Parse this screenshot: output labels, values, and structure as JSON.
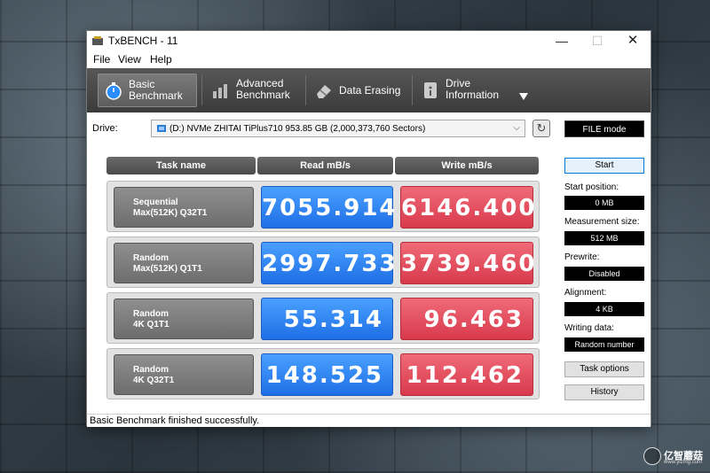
{
  "window": {
    "title": "TxBENCH - 11"
  },
  "menu": {
    "file": "File",
    "view": "View",
    "help": "Help"
  },
  "tabs": [
    {
      "label": "Basic\nBenchmark",
      "icon": "stopwatch-icon",
      "active": true
    },
    {
      "label": "Advanced\nBenchmark",
      "icon": "bar-chart-icon",
      "active": false
    },
    {
      "label": "Data Erasing",
      "icon": "eraser-icon",
      "active": false
    },
    {
      "label": "Drive\nInformation",
      "icon": "drive-info-icon",
      "active": false
    }
  ],
  "drive": {
    "label": "Drive:",
    "selected": "(D:) NVMe ZHITAI TiPlus710  953.85 GB (2,000,373,760 Sectors)",
    "mode_button": "FILE mode"
  },
  "table": {
    "headers": {
      "task": "Task name",
      "read": "Read mB/s",
      "write": "Write mB/s"
    },
    "rows": [
      {
        "line1": "Sequential",
        "line2": "Max(512K) Q32T1",
        "read": "7055.914",
        "write": "6146.400"
      },
      {
        "line1": "Random",
        "line2": "Max(512K) Q1T1",
        "read": "2997.733",
        "write": "3739.460"
      },
      {
        "line1": "Random",
        "line2": "4K Q1T1",
        "read": "55.314",
        "write": "96.463"
      },
      {
        "line1": "Random",
        "line2": "4K Q32T1",
        "read": "148.525",
        "write": "112.462"
      }
    ]
  },
  "side": {
    "start": "Start",
    "start_position_label": "Start position:",
    "start_position_value": "0 MB",
    "measurement_size_label": "Measurement size:",
    "measurement_size_value": "512 MB",
    "prewrite_label": "Prewrite:",
    "prewrite_value": "Disabled",
    "alignment_label": "Alignment:",
    "alignment_value": "4 KB",
    "writing_data_label": "Writing data:",
    "writing_data_value": "Random number",
    "task_options": "Task options",
    "history": "History"
  },
  "status": "Basic Benchmark finished successfully.",
  "watermark": {
    "text": "亿智蘑菇",
    "sub": "www.yizmg.com"
  },
  "colors": {
    "read": "#1e6fe6",
    "write": "#d83a4c",
    "toolbar": "#4a4a4a"
  }
}
